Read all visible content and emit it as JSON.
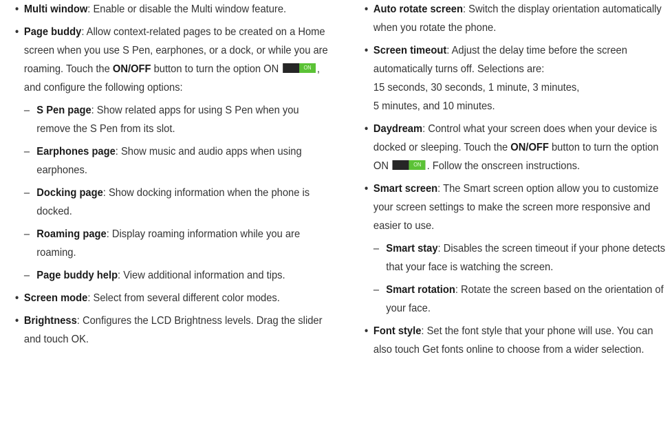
{
  "left": {
    "multi_window": {
      "term": "Multi window",
      "body": ": Enable or disable the Multi window feature."
    },
    "page_buddy": {
      "term": "Page buddy",
      "body_a": ": Allow context-related pages to be created on a Home screen when you use S Pen, earphones, or a dock, or while you are roaming. Touch the ",
      "onoff": "ON/OFF",
      "body_b": " button to turn the option ON ",
      "toggle_on": "ON",
      "body_c": ", and configure the following options:"
    },
    "s_pen_page": {
      "term": "S Pen page",
      "body": ": Show related apps for using S Pen when you remove the S Pen from its slot."
    },
    "earphones_page": {
      "term": "Earphones page",
      "body": ": Show music and audio apps when using earphones."
    },
    "docking_page": {
      "term": "Docking page",
      "body": ": Show docking information when the phone is docked."
    },
    "roaming_page": {
      "term": "Roaming page",
      "body": ": Display roaming information while you are roaming."
    },
    "page_buddy_help": {
      "term": "Page buddy help",
      "body": ": View additional information and tips."
    },
    "screen_mode": {
      "term": "Screen mode",
      "body": ": Select from several different color modes."
    },
    "brightness": {
      "term": "Brightness",
      "body": ": Configures the LCD Brightness levels. Drag the slider and touch OK."
    }
  },
  "right": {
    "auto_rotate": {
      "term": "Auto rotate screen",
      "body": ": Switch the display orientation automatically when you rotate the phone."
    },
    "screen_timeout": {
      "term": "Screen timeout",
      "body": ": Adjust the delay time before the screen automatically turns off. Selections are:",
      "line2": "15 seconds, 30 seconds, 1 minute, 3 minutes,",
      "line3": "5 minutes, and 10 minutes."
    },
    "daydream": {
      "term": "Daydream",
      "body_a": ": Control what your screen does when your device is docked or sleeping. Touch the ",
      "onoff": "ON/OFF",
      "body_b": " button to turn the option ON ",
      "toggle_on": "ON",
      "body_c": ". Follow the onscreen instructions."
    },
    "smart_screen": {
      "term": "Smart screen",
      "body": ": The Smart screen option allow you to customize your screen settings to make the screen more responsive and easier to use."
    },
    "smart_stay": {
      "term": "Smart stay",
      "body": ": Disables the screen timeout if your phone detects that your face is watching the screen."
    },
    "smart_rotation": {
      "term": "Smart rotation",
      "body": ": Rotate the screen based on the orientation of your face."
    },
    "font_style": {
      "term": "Font style",
      "body": ": Set the font style that your phone will use. You can also touch Get fonts online to choose from a wider selection."
    }
  },
  "bullet": "•",
  "dash": "–",
  "colors": {
    "toggle_track": "#262626",
    "toggle_on": "#5bc236",
    "text": "#333333"
  }
}
